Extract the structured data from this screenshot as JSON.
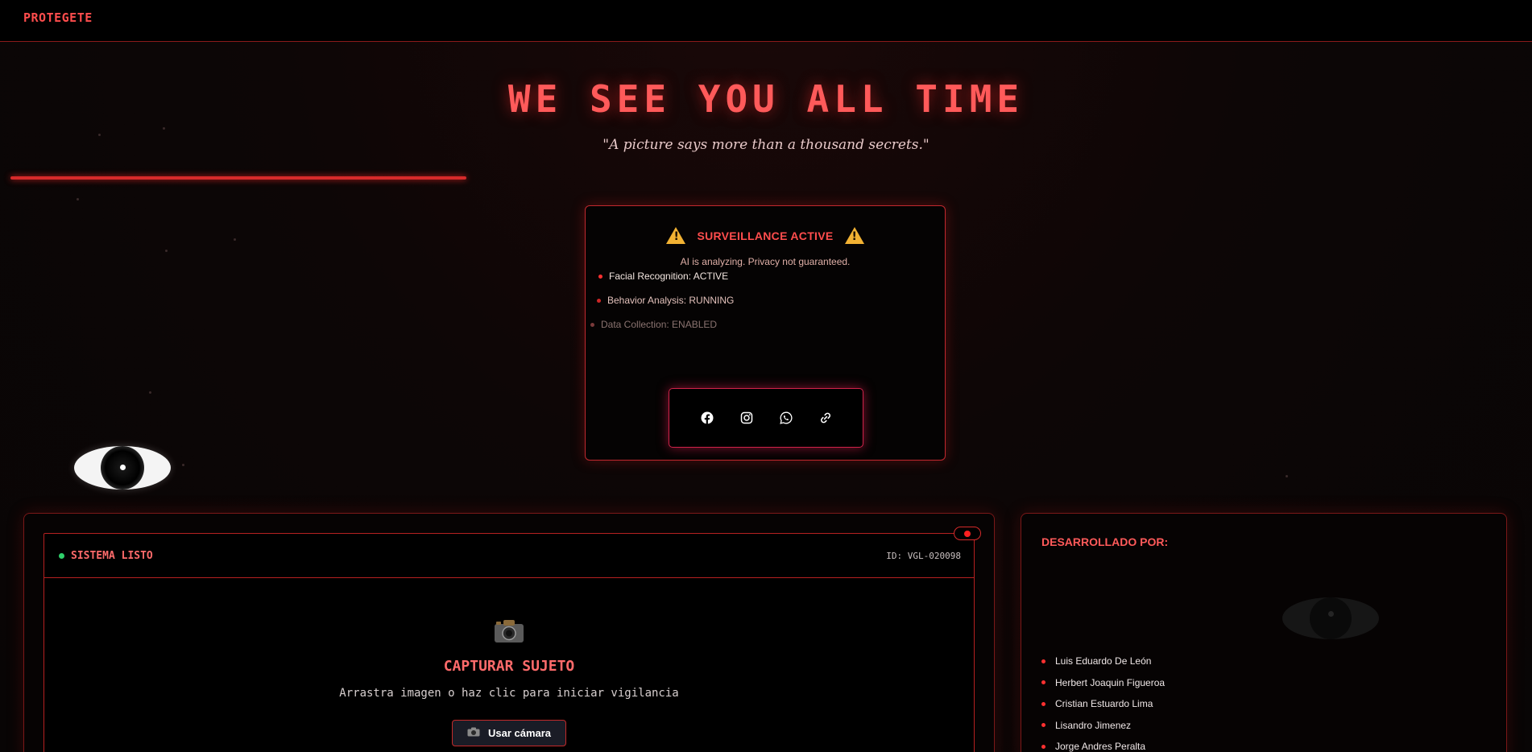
{
  "brand": "PROTEGETE",
  "hero": {
    "title": "WE SEE YOU ALL TIME",
    "subtitle": "\"A picture says more than a thousand secrets.\""
  },
  "surveillance": {
    "title": "SURVEILLANCE ACTIVE",
    "description": "AI is analyzing. Privacy not guaranteed.",
    "statuses": [
      {
        "label": "Facial Recognition: ACTIVE"
      },
      {
        "label": "Behavior Analysis: RUNNING"
      },
      {
        "label": "Data Collection: ENABLED"
      }
    ],
    "social": [
      {
        "name": "facebook-icon"
      },
      {
        "name": "instagram-icon"
      },
      {
        "name": "whatsapp-icon"
      },
      {
        "name": "link-icon"
      }
    ]
  },
  "capture": {
    "status": "SISTEMA LISTO",
    "id_label": "ID: VGL-020098",
    "title": "CAPTURAR SUJETO",
    "description": "Arrastra imagen o haz clic para iniciar vigilancia",
    "camera_button": "Usar cámara"
  },
  "developers": {
    "title": "DESARROLLADO POR:",
    "names": [
      "Luis Eduardo De León",
      "Herbert Joaquin Figueroa",
      "Cristian Estuardo Lima",
      "Lisandro Jimenez",
      "Jorge Andres Peralta"
    ]
  },
  "colors": {
    "accent": "#ff4d4d",
    "border": "#c0282e",
    "ready": "#2fd06b",
    "warning": "#f2b233"
  }
}
